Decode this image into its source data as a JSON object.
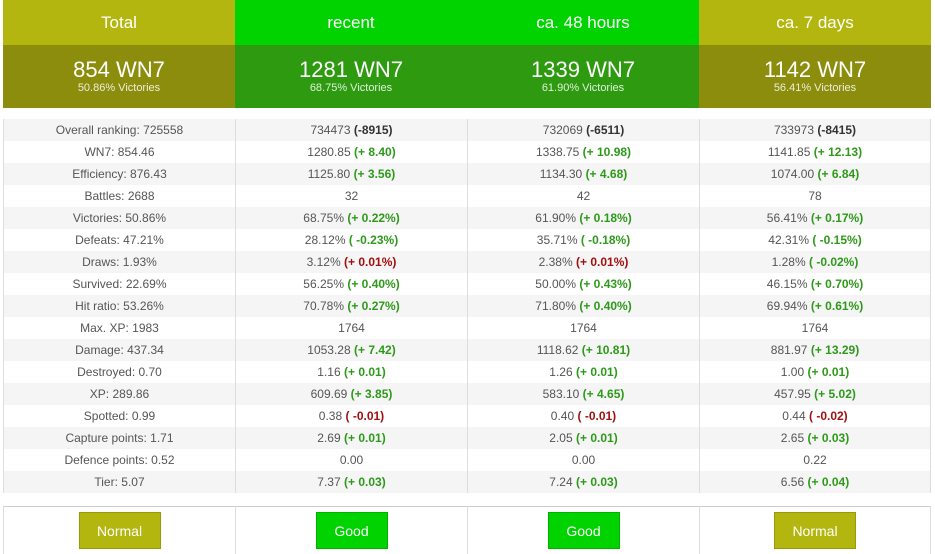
{
  "colors": {
    "olive": "#b3b60f",
    "olive_dark": "#8c8d0c",
    "green": "#00d300",
    "green_dark": "#2e9a10",
    "positive": "#2e9a1a",
    "negative": "#a01010"
  },
  "columns": [
    {
      "header": "Total",
      "wn7": "854 WN7",
      "victories": "50.86% Victories",
      "rating": "Normal",
      "rows": [
        {
          "v": "Overall ranking: 725558",
          "d": ""
        },
        {
          "v": "WN7: 854.46",
          "d": ""
        },
        {
          "v": "Efficiency: 876.43",
          "d": ""
        },
        {
          "v": "Battles: 2688",
          "d": ""
        },
        {
          "v": "Victories: 50.86%",
          "d": ""
        },
        {
          "v": "Defeats: 47.21%",
          "d": ""
        },
        {
          "v": "Draws: 1.93%",
          "d": ""
        },
        {
          "v": "Survived: 22.69%",
          "d": ""
        },
        {
          "v": "Hit ratio: 53.26%",
          "d": ""
        },
        {
          "v": "Max. XP: 1983",
          "d": ""
        },
        {
          "v": "Damage: 437.34",
          "d": ""
        },
        {
          "v": "Destroyed: 0.70",
          "d": ""
        },
        {
          "v": "XP: 289.86",
          "d": ""
        },
        {
          "v": "Spotted: 0.99",
          "d": ""
        },
        {
          "v": "Capture points: 1.71",
          "d": ""
        },
        {
          "v": "Defence points: 0.52",
          "d": ""
        },
        {
          "v": "Tier: 5.07",
          "d": ""
        }
      ]
    },
    {
      "header": "recent",
      "wn7": "1281 WN7",
      "victories": "68.75% Victories",
      "rating": "Good",
      "rows": [
        {
          "v": "734473",
          "d": "(-8915)",
          "t": "neu"
        },
        {
          "v": "1280.85",
          "d": "(+ 8.40)",
          "t": "pos"
        },
        {
          "v": "1125.80",
          "d": "(+ 3.56)",
          "t": "pos"
        },
        {
          "v": "32",
          "d": ""
        },
        {
          "v": "68.75%",
          "d": "(+ 0.22%)",
          "t": "pos"
        },
        {
          "v": "28.12%",
          "d": "( -0.23%)",
          "t": "pos"
        },
        {
          "v": "3.12%",
          "d": "(+ 0.01%)",
          "t": "neg"
        },
        {
          "v": "56.25%",
          "d": "(+ 0.40%)",
          "t": "pos"
        },
        {
          "v": "70.78%",
          "d": "(+ 0.27%)",
          "t": "pos"
        },
        {
          "v": "1764",
          "d": ""
        },
        {
          "v": "1053.28",
          "d": "(+ 7.42)",
          "t": "pos"
        },
        {
          "v": "1.16",
          "d": "(+ 0.01)",
          "t": "pos"
        },
        {
          "v": "609.69",
          "d": "(+ 3.85)",
          "t": "pos"
        },
        {
          "v": "0.38",
          "d": "( -0.01)",
          "t": "neg"
        },
        {
          "v": "2.69",
          "d": "(+ 0.01)",
          "t": "pos"
        },
        {
          "v": "0.00",
          "d": ""
        },
        {
          "v": "7.37",
          "d": "(+ 0.03)",
          "t": "pos"
        }
      ]
    },
    {
      "header": "ca. 48 hours",
      "wn7": "1339 WN7",
      "victories": "61.90% Victories",
      "rating": "Good",
      "rows": [
        {
          "v": "732069",
          "d": "(-6511)",
          "t": "neu"
        },
        {
          "v": "1338.75",
          "d": "(+ 10.98)",
          "t": "pos"
        },
        {
          "v": "1134.30",
          "d": "(+ 4.68)",
          "t": "pos"
        },
        {
          "v": "42",
          "d": ""
        },
        {
          "v": "61.90%",
          "d": "(+ 0.18%)",
          "t": "pos"
        },
        {
          "v": "35.71%",
          "d": "( -0.18%)",
          "t": "pos"
        },
        {
          "v": "2.38%",
          "d": "(+ 0.01%)",
          "t": "neg"
        },
        {
          "v": "50.00%",
          "d": "(+ 0.43%)",
          "t": "pos"
        },
        {
          "v": "71.80%",
          "d": "(+ 0.40%)",
          "t": "pos"
        },
        {
          "v": "1764",
          "d": ""
        },
        {
          "v": "1118.62",
          "d": "(+ 10.81)",
          "t": "pos"
        },
        {
          "v": "1.26",
          "d": "(+ 0.01)",
          "t": "pos"
        },
        {
          "v": "583.10",
          "d": "(+ 4.65)",
          "t": "pos"
        },
        {
          "v": "0.40",
          "d": "( -0.01)",
          "t": "neg"
        },
        {
          "v": "2.05",
          "d": "(+ 0.01)",
          "t": "pos"
        },
        {
          "v": "0.00",
          "d": ""
        },
        {
          "v": "7.24",
          "d": "(+ 0.03)",
          "t": "pos"
        }
      ]
    },
    {
      "header": "ca. 7 days",
      "wn7": "1142 WN7",
      "victories": "56.41% Victories",
      "rating": "Normal",
      "rows": [
        {
          "v": "733973",
          "d": "(-8415)",
          "t": "neu"
        },
        {
          "v": "1141.85",
          "d": "(+ 12.13)",
          "t": "pos"
        },
        {
          "v": "1074.00",
          "d": "(+ 6.84)",
          "t": "pos"
        },
        {
          "v": "78",
          "d": ""
        },
        {
          "v": "56.41%",
          "d": "(+ 0.17%)",
          "t": "pos"
        },
        {
          "v": "42.31%",
          "d": "( -0.15%)",
          "t": "pos"
        },
        {
          "v": "1.28%",
          "d": "( -0.02%)",
          "t": "pos"
        },
        {
          "v": "46.15%",
          "d": "(+ 0.70%)",
          "t": "pos"
        },
        {
          "v": "69.94%",
          "d": "(+ 0.61%)",
          "t": "pos"
        },
        {
          "v": "1764",
          "d": ""
        },
        {
          "v": "881.97",
          "d": "(+ 13.29)",
          "t": "pos"
        },
        {
          "v": "1.00",
          "d": "(+ 0.01)",
          "t": "pos"
        },
        {
          "v": "457.95",
          "d": "(+ 5.02)",
          "t": "pos"
        },
        {
          "v": "0.44",
          "d": "( -0.02)",
          "t": "neg"
        },
        {
          "v": "2.65",
          "d": "(+ 0.03)",
          "t": "pos"
        },
        {
          "v": "0.22",
          "d": ""
        },
        {
          "v": "6.56",
          "d": "(+ 0.04)",
          "t": "pos"
        }
      ]
    }
  ]
}
